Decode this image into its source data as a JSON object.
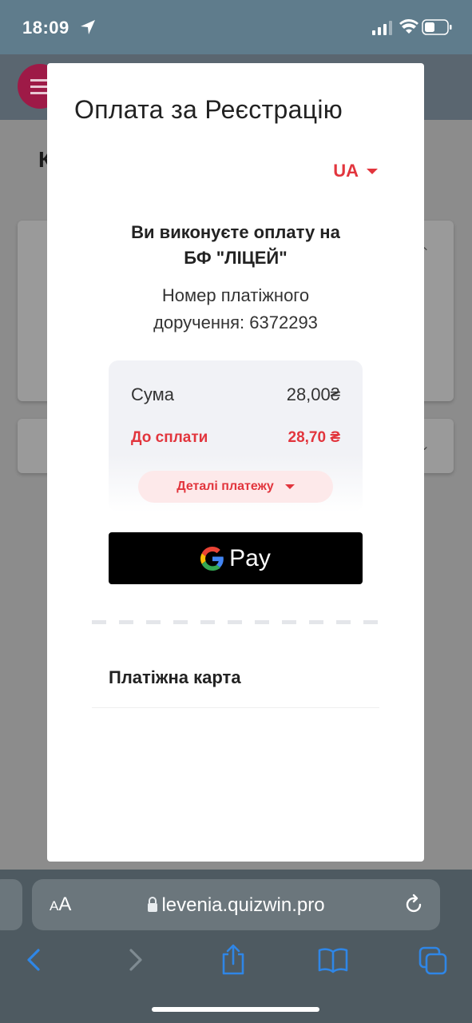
{
  "status_bar": {
    "time": "18:09"
  },
  "page": {
    "heading_fragment": "К"
  },
  "modal": {
    "title": "Оплата за Реєстрацію",
    "language": "UA",
    "payee_line1": "Ви виконуєте оплату на",
    "payee_line2": "БФ \"ЛІЦЕЙ\"",
    "order_line1": "Номер платіжного",
    "order_line2": "доручення: 6372293",
    "summary": {
      "sum_label": "Сума",
      "sum_value": "28,00₴",
      "to_pay_label": "До сплати",
      "to_pay_value": "28,70 ₴",
      "details_label": "Деталі платежу"
    },
    "gpay_label": "Pay",
    "card_section_label": "Платіжна карта"
  },
  "browser": {
    "text_size_label_small": "A",
    "text_size_label_large": "A",
    "url": "levenia.quizwin.pro"
  },
  "colors": {
    "accent": "#e2353d",
    "status_bar": "#5f7c8c",
    "safari_icon": "#2f86e6"
  }
}
